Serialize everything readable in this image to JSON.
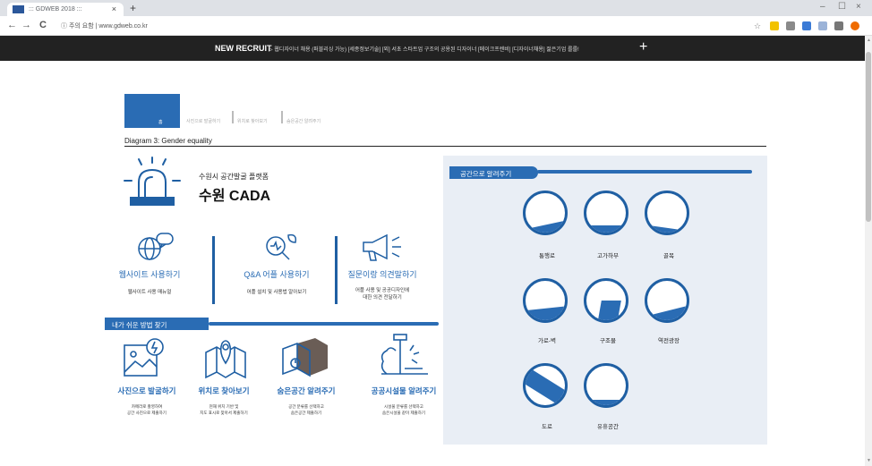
{
  "browser": {
    "tab_title": "::: GDWEB 2018 :::",
    "tab_close": "×",
    "new_tab": "+",
    "url": "ⓘ 주의 요함 | www.gdweb.co.kr",
    "nav_back": "←",
    "nav_forward": "→",
    "nav_reload": "C",
    "win_minimize": "–",
    "win_maximize": "☐",
    "win_close": "×"
  },
  "banner": {
    "title": "NEW RECRUIT",
    "text": "▷ 웹디자이너 채용 (퍼블리싱 가능)  [세종정보기술] [외] 서초 스타트업 구조의 공용된 디자이너  [메이크프렌비] [디자이너채용] 젊은기업 를를!",
    "plus": "+"
  },
  "subnav": {
    "home": "홈",
    "links": [
      "사진으로 발굴하기",
      "위치로 찾아보기",
      "숨은공간 알려주기"
    ]
  },
  "heading": "Diagram 3: Gender equality",
  "hero": {
    "subtitle": "수원시 공간발굴 플랫폼",
    "title": "수원 CADA"
  },
  "features": [
    {
      "title": "웹사이트 사용하기",
      "desc": "웹사이트 사용 매뉴얼",
      "icon": "globe-chat-icon"
    },
    {
      "title": "Q&A 어플 사용하기",
      "desc": "어플 설치 및 사용법 알아보기",
      "icon": "magnifier-leaf-icon"
    },
    {
      "title": "질문이랑 의견말하기",
      "desc": "어플 사용 및 공공디자인에\n대한 의견 전달하기",
      "icon": "megaphone-icon"
    }
  ],
  "section": {
    "title": "내가 쉬운 방법 찾기"
  },
  "bottom_items": [
    {
      "title": "사진으로 발굴하기",
      "desc": "카메라로 촬영하여\n공간 사진으로 제출하기",
      "icon": "photo-location-icon"
    },
    {
      "title": "위치로 찾아보기",
      "desc": "현재 위치 기반 및\n지도 표시로 찾아서 제출하기",
      "icon": "map-pin-icon"
    },
    {
      "title": "숨은공간 알려주기",
      "desc": "공간 분류를 선택하고\n숨은공간 제출하기",
      "icon": "hidden-space-icon"
    },
    {
      "title": "공공시설물 알려주기",
      "desc": "시설물 분류를 선택하고\n숨은시설물 같이 제출하기",
      "icon": "public-facility-icon"
    }
  ],
  "panel": {
    "title": "공간으로 알려주기",
    "items": [
      "통행로",
      "고가하부",
      "골목",
      "가로-벽",
      "구조물",
      "역전광장",
      "도로",
      "유휴공간"
    ]
  },
  "colors": {
    "accent": "#2a6cb4",
    "dark": "#1f5fa3",
    "panel_bg": "#e9eef5"
  }
}
